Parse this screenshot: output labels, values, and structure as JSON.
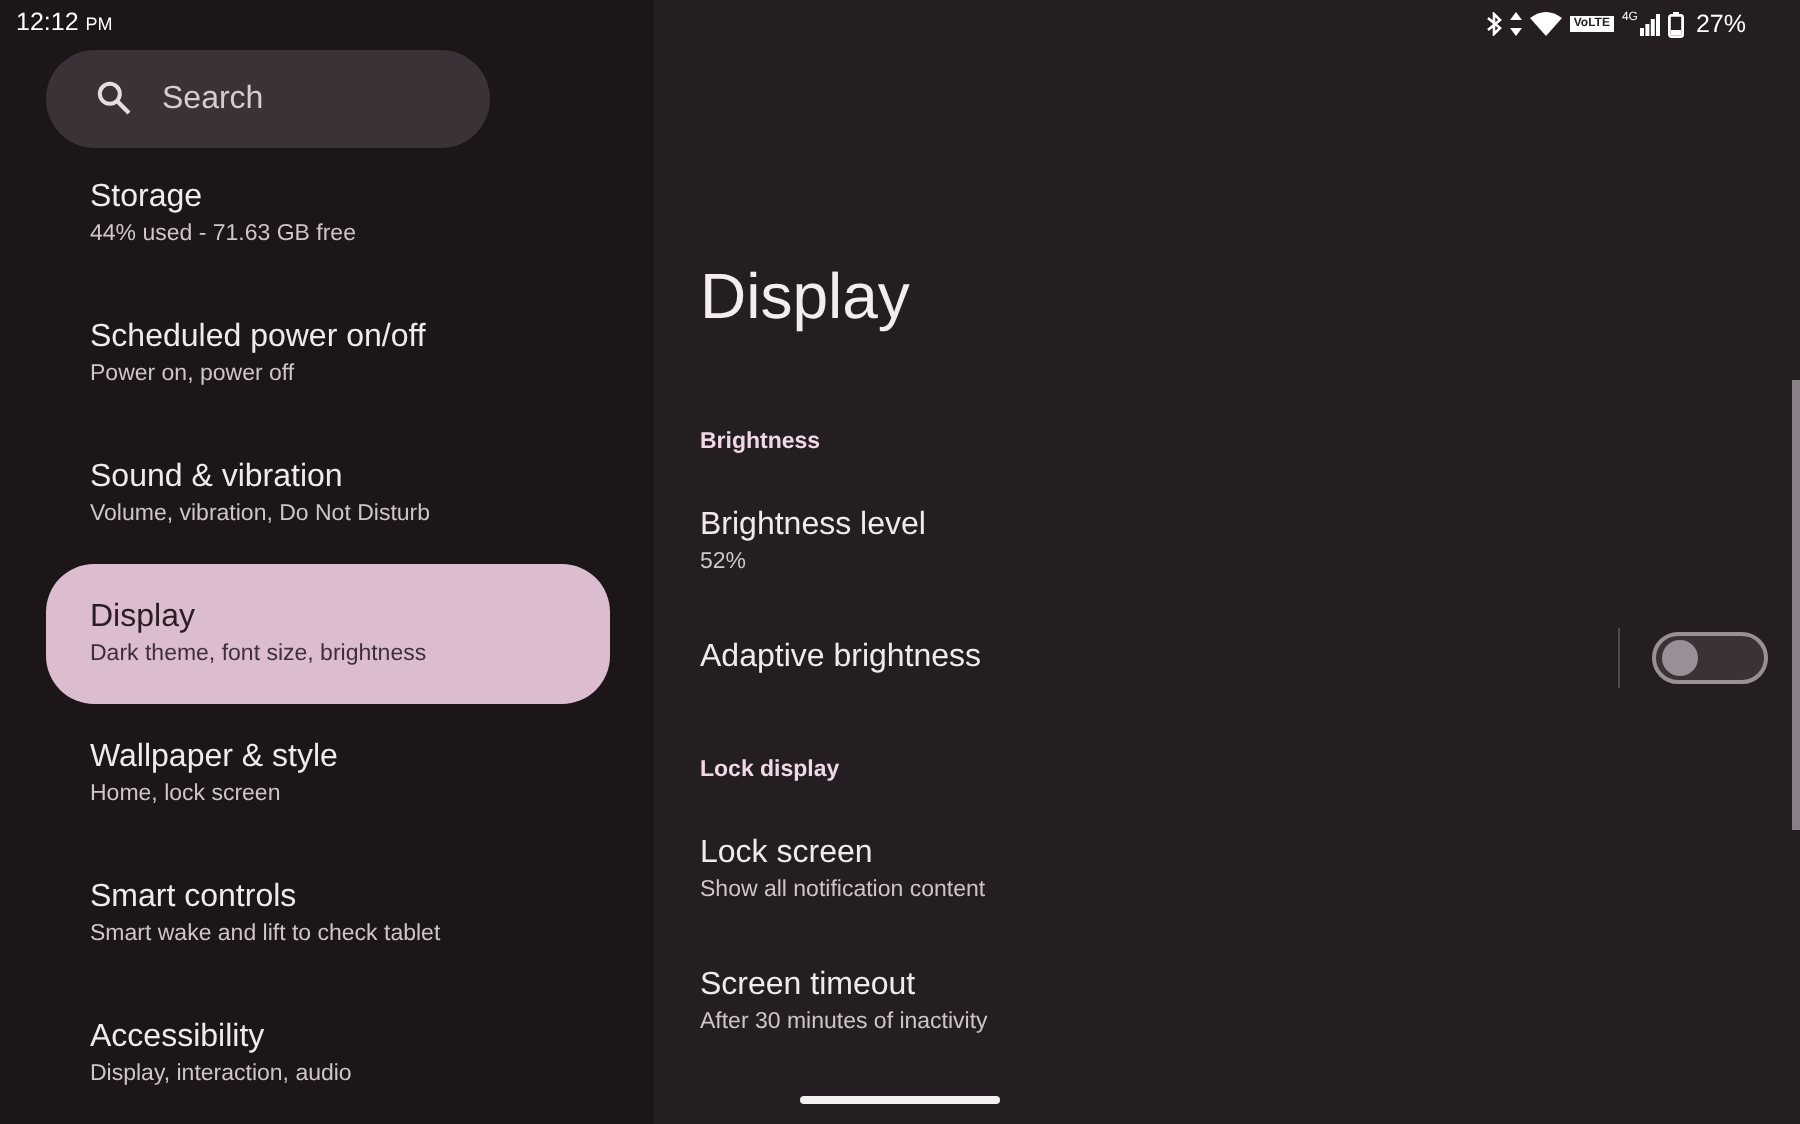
{
  "status_bar": {
    "time": "12:12",
    "meridiem": "PM",
    "volte_label": "VoLTE",
    "network": "4G",
    "battery": "27%"
  },
  "search": {
    "placeholder": "Search"
  },
  "sidebar": {
    "items": [
      {
        "title": "Storage",
        "subtitle": "44% used - 71.63 GB free",
        "selected": false
      },
      {
        "title": "Scheduled power on/off",
        "subtitle": "Power on, power off",
        "selected": false
      },
      {
        "title": "Sound & vibration",
        "subtitle": "Volume, vibration, Do Not Disturb",
        "selected": false
      },
      {
        "title": "Display",
        "subtitle": "Dark theme, font size, brightness",
        "selected": true
      },
      {
        "title": "Wallpaper & style",
        "subtitle": "Home, lock screen",
        "selected": false
      },
      {
        "title": "Smart controls",
        "subtitle": "Smart wake and lift to check tablet",
        "selected": false
      },
      {
        "title": "Accessibility",
        "subtitle": "Display, interaction, audio",
        "selected": false
      }
    ]
  },
  "page": {
    "title": "Display",
    "rows": [
      {
        "kind": "header",
        "title": "Brightness"
      },
      {
        "kind": "item",
        "title": "Brightness level",
        "subtitle": "52%"
      },
      {
        "kind": "switch",
        "title": "Adaptive brightness",
        "on": false
      },
      {
        "kind": "header",
        "title": "Lock display"
      },
      {
        "kind": "item",
        "title": "Lock screen",
        "subtitle": "Show all notification content"
      },
      {
        "kind": "item",
        "title": "Screen timeout",
        "subtitle": "After 30 minutes of inactivity"
      }
    ]
  }
}
